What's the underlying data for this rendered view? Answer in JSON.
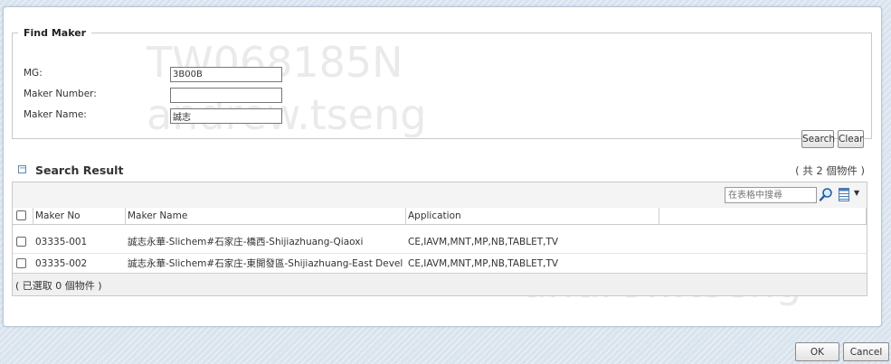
{
  "watermark": {
    "line1": "TW068185N",
    "line2": "andrew.tseng"
  },
  "find_maker": {
    "legend": "Find Maker",
    "fields": [
      {
        "label": "MG:",
        "value": "3B00B"
      },
      {
        "label": "Maker Number:",
        "value": ""
      },
      {
        "label": "Maker Name:",
        "value": "誠志"
      }
    ],
    "search_label": "Search",
    "clear_label": "Clear"
  },
  "search_result": {
    "title": "Search Result",
    "count_text": "( 共 2 個物件 )",
    "search_placeholder": "在表格中搜尋",
    "columns": [
      "Maker No",
      "Maker Name",
      "Application"
    ],
    "rows": [
      {
        "maker_no": "03335-001",
        "maker_name": "誠志永華-Slichem#石家庄-橋西-Shijiazhuang-Qiaoxi",
        "application": "CE,IAVM,MNT,MP,NB,TABLET,TV"
      },
      {
        "maker_no": "03335-002",
        "maker_name": "誠志永華-Slichem#石家庄-東開發區-Shijiazhuang-East Devel...",
        "application": "CE,IAVM,MNT,MP,NB,TABLET,TV"
      }
    ],
    "selected_text": "( 已選取 0 個物件 )"
  },
  "dialog_buttons": {
    "ok_label": "OK",
    "cancel_label": "Cancel"
  }
}
